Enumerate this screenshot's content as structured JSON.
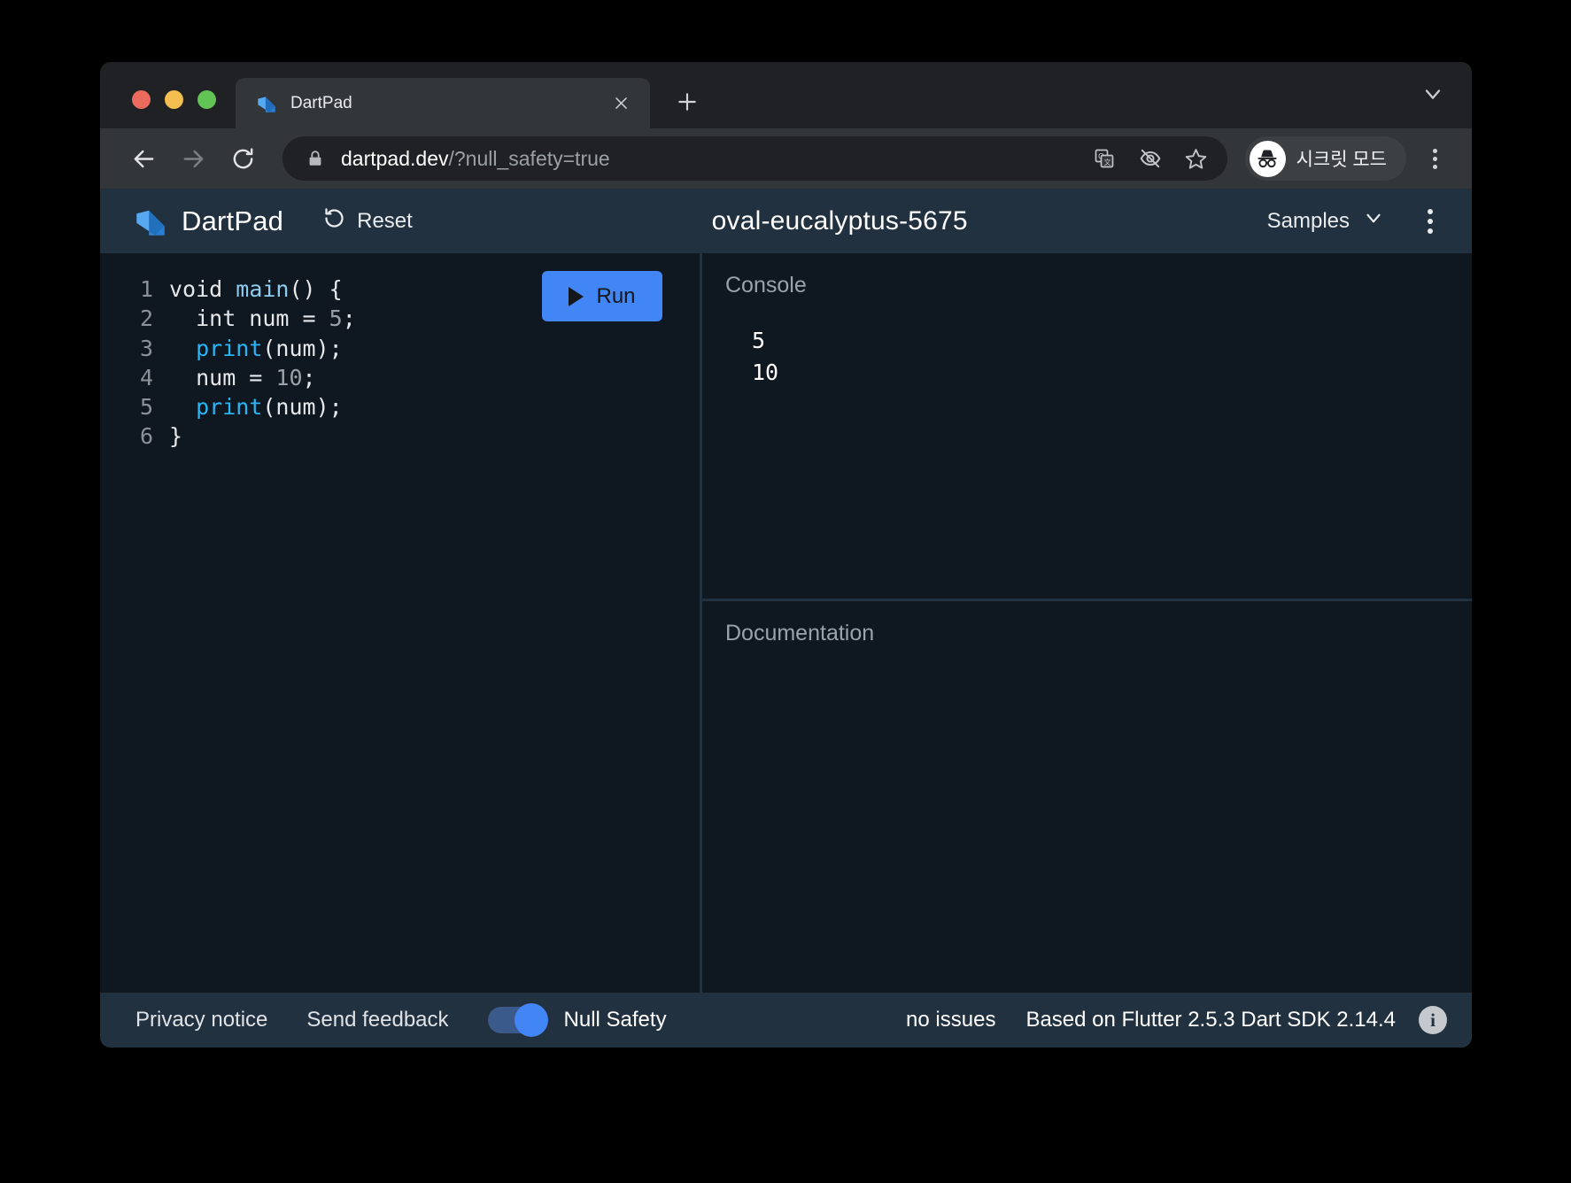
{
  "browser": {
    "tab": {
      "title": "DartPad",
      "favicon_icon": "dart-logo-icon",
      "close_icon": "close-icon"
    },
    "new_tab_label": "+",
    "tabstrip_chevron_icon": "chevron-down-icon",
    "toolbar": {
      "back_icon": "arrow-left-icon",
      "forward_icon": "arrow-right-icon",
      "reload_icon": "reload-icon",
      "lock_icon": "lock-icon",
      "url_host": "dartpad.dev",
      "url_path": "/?null_safety=true",
      "translate_icon": "translate-icon",
      "eye_off_icon": "eye-slash-icon",
      "bookmark_icon": "star-icon",
      "incognito_icon": "incognito-avatar-icon",
      "incognito_label": "시크릿 모드",
      "menu_icon": "kebab-menu-icon"
    }
  },
  "dartpad": {
    "header": {
      "logo_icon": "dart-logo-icon",
      "brand": "DartPad",
      "reset_icon": "refresh-icon",
      "reset_label": "Reset",
      "project_title": "oval-eucalyptus-5675",
      "samples_label": "Samples",
      "samples_chevron_icon": "chevron-down-icon",
      "kebab_icon": "kebab-menu-icon"
    },
    "editor": {
      "run_button_label": "Run",
      "run_icon": "play-icon",
      "lines": [
        {
          "number": "1",
          "tokens": [
            {
              "t": "void",
              "c": "tok-kw"
            },
            {
              "t": " ",
              "c": "tok-plain"
            },
            {
              "t": "main",
              "c": "tok-fn"
            },
            {
              "t": "() {",
              "c": "tok-punc"
            }
          ]
        },
        {
          "number": "2",
          "tokens": [
            {
              "t": "  int num = ",
              "c": "tok-plain"
            },
            {
              "t": "5",
              "c": "tok-num"
            },
            {
              "t": ";",
              "c": "tok-punc"
            }
          ]
        },
        {
          "number": "3",
          "tokens": [
            {
              "t": "  ",
              "c": "tok-plain"
            },
            {
              "t": "print",
              "c": "tok-call"
            },
            {
              "t": "(num);",
              "c": "tok-punc"
            }
          ]
        },
        {
          "number": "4",
          "tokens": [
            {
              "t": "  num = ",
              "c": "tok-plain"
            },
            {
              "t": "10",
              "c": "tok-num"
            },
            {
              "t": ";",
              "c": "tok-punc"
            }
          ]
        },
        {
          "number": "5",
          "tokens": [
            {
              "t": "  ",
              "c": "tok-plain"
            },
            {
              "t": "print",
              "c": "tok-call"
            },
            {
              "t": "(num);",
              "c": "tok-punc"
            }
          ]
        },
        {
          "number": "6",
          "tokens": [
            {
              "t": "}",
              "c": "tok-punc"
            }
          ]
        }
      ]
    },
    "console": {
      "title": "Console",
      "output": "5\n10"
    },
    "documentation": {
      "title": "Documentation",
      "output": ""
    },
    "status": {
      "privacy_label": "Privacy notice",
      "feedback_label": "Send feedback",
      "null_safety_label": "Null Safety",
      "null_safety_on": true,
      "issues": "no issues",
      "version": "Based on Flutter 2.5.3 Dart SDK 2.14.4",
      "info_icon": "info-icon",
      "info_glyph": "i"
    }
  },
  "colors": {
    "accent_blue": "#4285f4",
    "app_bg": "#1c2834",
    "panel_bg": "#0f1720",
    "header_bg": "#22313f",
    "browser_chrome": "#323639",
    "browser_frame": "#202124"
  }
}
